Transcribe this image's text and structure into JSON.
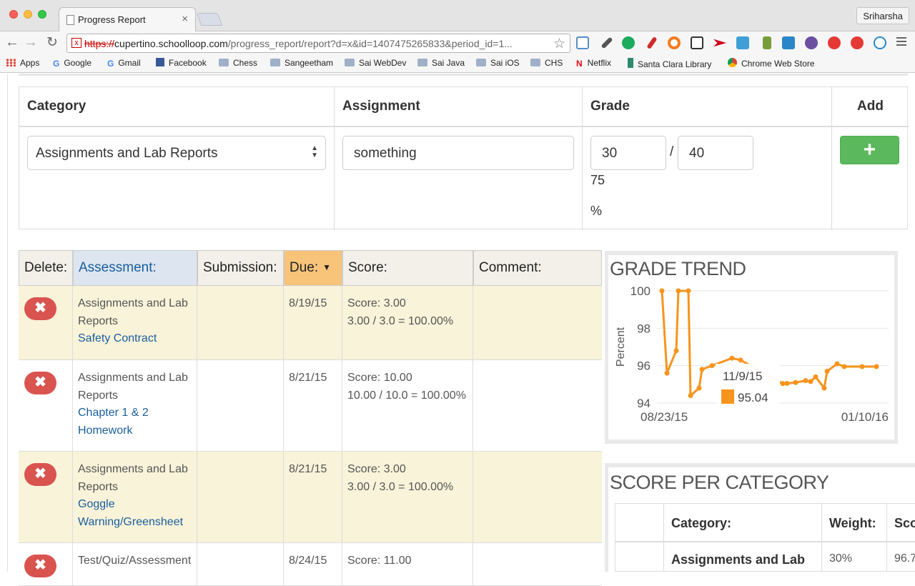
{
  "browser": {
    "tab_title": "Progress Report",
    "tab_close": "×",
    "profile_name": "Sriharsha",
    "url_protocol": "https://",
    "url_host": "cupertino.schoolloop.com",
    "url_path": "/progress_report/report?d=x&id=1407475265833&period_id=1...",
    "bookmarks": [
      "Apps",
      "Google",
      "Gmail",
      "Facebook",
      "Chess",
      "Sangeetham",
      "Sai WebDev",
      "Sai Java",
      "Sai iOS",
      "CHS",
      "Netflix",
      "Santa Clara Library",
      "Chrome Web Store"
    ]
  },
  "add_form": {
    "headers": {
      "category": "Category",
      "assignment": "Assignment",
      "grade": "Grade",
      "add": "Add"
    },
    "category_value": "Assignments and Lab Reports",
    "assignment_value": "something",
    "score_value": "30",
    "max_value": "40",
    "slash": "/",
    "percent_value": "75",
    "percent_sign": "%",
    "add_button_label": "+"
  },
  "assessments": {
    "headers": {
      "delete": "Delete:",
      "assessment": "Assessment:",
      "submission": "Submission:",
      "due": "Due:",
      "score": "Score:",
      "comment": "Comment:"
    },
    "sort_indicator": "▼",
    "delete_label": "✖",
    "rows": [
      {
        "category": "Assignments and Lab Reports",
        "title": "Safety Contract",
        "due": "8/19/15",
        "score": "Score: 3.00",
        "detail": "3.00 / 3.0 = 100.00%"
      },
      {
        "category": "Assignments and Lab Reports",
        "title": "Chapter 1 & 2 Homework",
        "due": "8/21/15",
        "score": "Score: 10.00",
        "detail": "10.00 / 10.0 = 100.00%"
      },
      {
        "category": "Assignments and Lab Reports",
        "title": "Goggle Warning/Greensheet",
        "due": "8/21/15",
        "score": "Score: 3.00",
        "detail": "3.00 / 3.0 = 100.00%"
      },
      {
        "category": "Test/Quiz/Assessment",
        "title": "",
        "due": "8/24/15",
        "score": "Score: 11.00",
        "detail": ""
      }
    ]
  },
  "grade_trend": {
    "title": "GRADE TREND",
    "tooltip_date": "11/9/15",
    "tooltip_value": "95.04",
    "accent_color": "#f7941d"
  },
  "chart_data": {
    "type": "line",
    "title": "GRADE TREND",
    "xlabel": "",
    "ylabel": "Percent",
    "ylim": [
      94,
      100
    ],
    "yticks": [
      "100",
      "98",
      "96",
      "94"
    ],
    "xticks": [
      "08/23/15",
      "01/10/16"
    ],
    "grid": true,
    "series": [
      {
        "values": [
          100,
          95.6,
          96.8,
          100,
          100,
          94.4,
          94.8,
          95.8,
          96.0,
          96.4,
          96.3,
          95.04,
          95.05,
          95.1,
          95.2,
          95.15,
          95.4,
          94.8,
          95.7,
          96.1,
          95.95,
          95.95,
          95.95
        ]
      }
    ]
  },
  "score_per_category": {
    "title": "SCORE PER CATEGORY",
    "headers": {
      "category": "Category:",
      "weight": "Weight:",
      "score": "Score:"
    },
    "rows": [
      {
        "category": "Assignments and Lab",
        "weight": "30%",
        "score": "96.7"
      }
    ]
  }
}
